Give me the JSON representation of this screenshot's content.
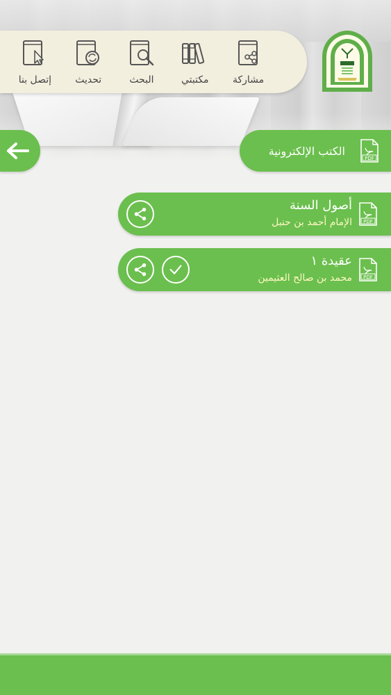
{
  "toolbar": {
    "items": [
      {
        "label": "مشاركة",
        "icon": "share-book-icon"
      },
      {
        "label": "مكتبتي",
        "icon": "library-icon"
      },
      {
        "label": "البحث",
        "icon": "search-book-icon"
      },
      {
        "label": "تحديث",
        "icon": "refresh-book-icon"
      },
      {
        "label": "إتصل بنا",
        "icon": "contact-book-icon"
      }
    ]
  },
  "section": {
    "title": "الكتب الإلكترونية",
    "icon": "pdf-icon"
  },
  "books": [
    {
      "title": "أصول السنة",
      "author": "الإمام أحمد بن حنبل",
      "actions": [
        "share-icon"
      ]
    },
    {
      "title": "عقيدة ١",
      "author": "محمد بن صالح العثيمين",
      "actions": [
        "share-icon",
        "check-icon"
      ]
    }
  ],
  "colors": {
    "accent": "#6bbf4e",
    "toolbar_bg": "#f3efdf",
    "author_text": "#fff8c4",
    "icon_stroke": "#555555"
  }
}
